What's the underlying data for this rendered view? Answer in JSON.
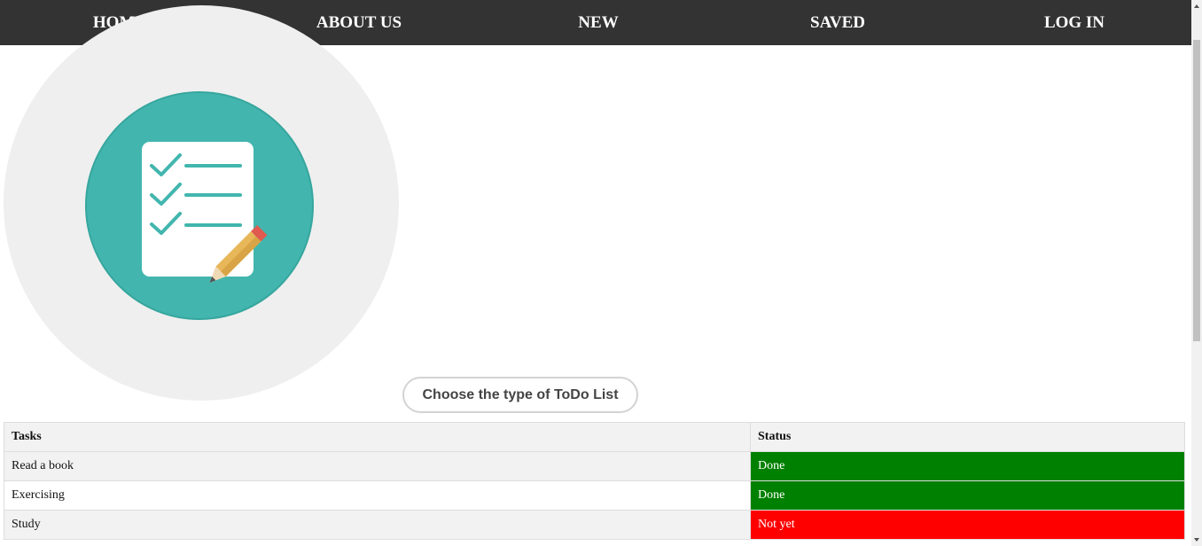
{
  "nav": {
    "items": [
      {
        "label": "HOME"
      },
      {
        "label": "ABOUT US"
      },
      {
        "label": "NEW"
      },
      {
        "label": "SAVED"
      },
      {
        "label": "LOG IN"
      }
    ]
  },
  "hero": {
    "icon": "todo-checklist-pencil-icon",
    "colors": {
      "outer_circle": "#efefef",
      "inner_circle": "#42b6ae",
      "paper": "#ffffff",
      "check_lines": "#42b6ae",
      "pencil_body": "#e8b75a",
      "pencil_eraser": "#e05a4f"
    }
  },
  "choose_button": {
    "label": "Choose the type of ToDo List"
  },
  "table": {
    "headers": {
      "tasks": "Tasks",
      "status": "Status"
    },
    "rows": [
      {
        "task": "Read a book",
        "status": "Done",
        "status_color": "#008000"
      },
      {
        "task": "Exercising",
        "status": "Done",
        "status_color": "#008000"
      },
      {
        "task": "Study",
        "status": "Not yet",
        "status_color": "#ff0000"
      }
    ]
  },
  "colors": {
    "navbar_bg": "#333333",
    "navbar_text": "#ffffff",
    "done": "#008000",
    "not_yet": "#ff0000"
  }
}
